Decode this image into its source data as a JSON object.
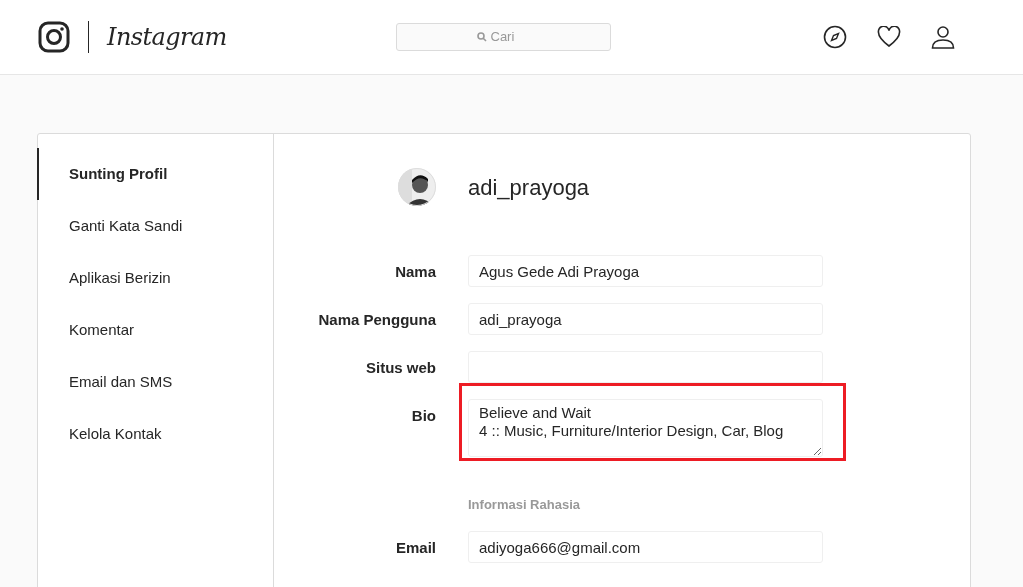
{
  "header": {
    "logo_text": "Instagram",
    "search": {
      "placeholder": "Cari"
    }
  },
  "sidebar": {
    "items": [
      {
        "label": "Sunting Profil",
        "selected": true
      },
      {
        "label": "Ganti Kata Sandi",
        "selected": false
      },
      {
        "label": "Aplikasi Berizin",
        "selected": false
      },
      {
        "label": "Komentar",
        "selected": false
      },
      {
        "label": "Email dan SMS",
        "selected": false
      },
      {
        "label": "Kelola Kontak",
        "selected": false
      }
    ]
  },
  "profile": {
    "username": "adi_prayoga"
  },
  "form": [
    {
      "kind": "input",
      "label": "Nama",
      "value": "Agus Gede Adi Prayoga",
      "highlighted": false
    },
    {
      "kind": "input",
      "label": "Nama Pengguna",
      "value": "adi_prayoga",
      "highlighted": false
    },
    {
      "kind": "input",
      "label": "Situs web",
      "highlighted": false
    },
    {
      "kind": "textarea",
      "label": "Bio",
      "value": "Believe and Wait\n4 :: Music, Furniture/Interior Design, Car, Blog",
      "highlighted": true
    },
    {
      "kind": "heading",
      "label": "Informasi Rahasia"
    },
    {
      "kind": "input",
      "label": "Email",
      "value": "adiyoga666@gmail.com",
      "highlighted": false
    }
  ]
}
